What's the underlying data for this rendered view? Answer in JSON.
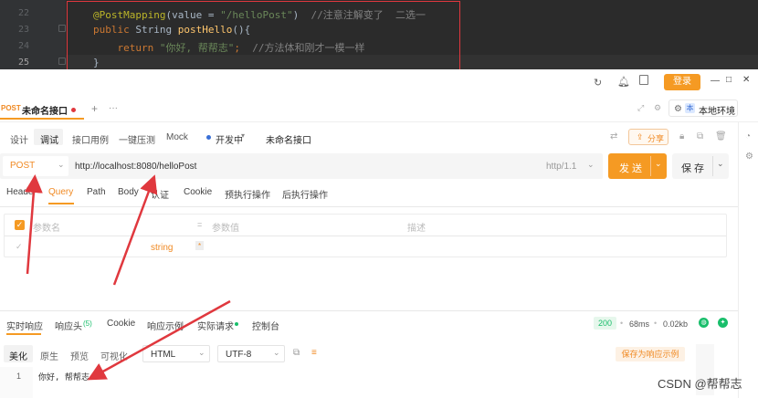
{
  "editor": {
    "lines": [
      {
        "num": "22",
        "parts": [
          [
            "anno",
            "@PostMapping"
          ],
          [
            "tx",
            "(value = "
          ],
          [
            "str",
            "\"/helloPost\""
          ],
          [
            "tx",
            ")  "
          ],
          [
            "cm",
            "//注意注解变了  二选一"
          ]
        ]
      },
      {
        "num": "23",
        "parts": [
          [
            "kw",
            "public "
          ],
          [
            "tx",
            "String "
          ],
          [
            "fn",
            "postHello"
          ],
          [
            "tx",
            "(){"
          ]
        ]
      },
      {
        "num": "24",
        "parts": [
          [
            "tx",
            "    "
          ],
          [
            "kw",
            "return "
          ],
          [
            "str",
            "\"你好, 帮帮志\""
          ],
          [
            "kw",
            ";"
          ],
          [
            "tx",
            "  "
          ],
          [
            "cm",
            "//方法体和刚才一模一样"
          ]
        ]
      },
      {
        "num": "25",
        "parts": [
          [
            "tx",
            "}"
          ]
        ]
      }
    ]
  },
  "titlebar": {
    "login_label": "登录",
    "window_controls": [
      "—",
      "□",
      "✕"
    ]
  },
  "tabbar": {
    "method": "POST",
    "tab_title": "未命名接口",
    "add": "+",
    "more": "···",
    "env_badge": "本",
    "env_label": "本地环境"
  },
  "toolbar": {
    "tabs": [
      "设计",
      "调试",
      "接口用例",
      "一键压测",
      "Mock"
    ],
    "active_tab": "调试",
    "status": "开发中",
    "name": "未命名接口",
    "share_label": "分享"
  },
  "request": {
    "method": "POST",
    "url": "http://localhost:8080/helloPost",
    "protocol": "http/1.1",
    "send_label": "发 送",
    "save_label": "保 存"
  },
  "params": {
    "tabs": [
      "Header",
      "Query",
      "Path",
      "Body",
      "认证",
      "Cookie",
      "预执行操作",
      "后执行操作"
    ],
    "active_tab": "Query",
    "col_name": "参数名",
    "col_value": "参数值",
    "col_desc": "描述",
    "row_type": "string",
    "row_marker": "*"
  },
  "response": {
    "tabs": [
      "实时响应",
      "响应头",
      "Cookie",
      "响应示例",
      "实际请求",
      "控制台"
    ],
    "header_count": "(5)",
    "active_tab": "实时响应",
    "status_code": "200",
    "time": "68ms",
    "size": "0.02kb",
    "format_tabs": [
      "美化",
      "原生",
      "预览",
      "可视化"
    ],
    "active_format": "美化",
    "format_select": "HTML",
    "encoding_select": "UTF-8",
    "save_example": "保存为响应示例",
    "body_line_num": "1",
    "body_text": "你好, 帮帮志"
  },
  "watermark": "CSDN @帮帮志",
  "colors": {
    "accent": "#f59a23",
    "arrow": "#e0383e",
    "editor_bg": "#2b2b2b",
    "status_ok": "#19be6b"
  }
}
